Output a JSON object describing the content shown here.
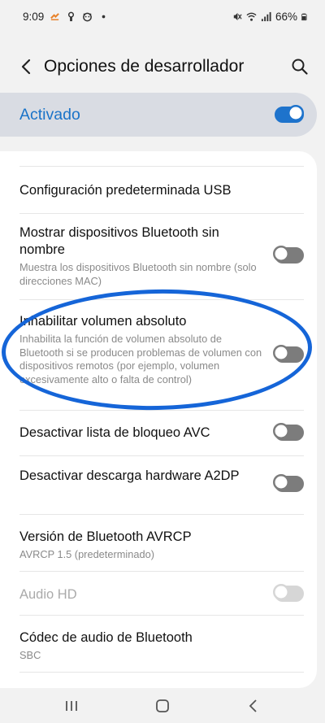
{
  "status_bar": {
    "time": "9:09",
    "battery": "66%",
    "icons": [
      "missed-call-icon",
      "lock-icon",
      "mascot-icon",
      "dot-icon",
      "mute-icon",
      "wifi-icon",
      "signal-icon",
      "battery-icon"
    ]
  },
  "header": {
    "title": "Opciones de desarrollador",
    "back_icon": "back-arrow-icon",
    "search_icon": "search-icon"
  },
  "master": {
    "label": "Activado",
    "enabled": true
  },
  "settings": [
    {
      "title": "Configuración predeterminada USB",
      "subtitle": "",
      "toggle": "none"
    },
    {
      "title": "Mostrar dispositivos Bluetooth sin nombre",
      "subtitle": "Muestra los dispositivos Bluetooth sin nombre (solo direcciones MAC)",
      "toggle": "off"
    },
    {
      "title": "Inhabilitar volumen absoluto",
      "subtitle": "Inhabilita la función de volumen absoluto de Bluetooth si se producen problemas de volumen con dispositivos remotos (por ejemplo, volumen excesivamente alto o falta de control)",
      "toggle": "off"
    },
    {
      "title": "Desactivar lista de bloqueo AVC",
      "subtitle": "",
      "toggle": "off"
    },
    {
      "title": "Desactivar descarga hardware A2DP",
      "subtitle": "",
      "toggle": "off"
    },
    {
      "title": "Versión de Bluetooth AVRCP",
      "subtitle": "AVRCP 1.5 (predeterminado)",
      "toggle": "none"
    },
    {
      "title": "Audio HD",
      "subtitle": "",
      "toggle": "disabled"
    },
    {
      "title": "Códec de audio de Bluetooth",
      "subtitle": "SBC",
      "toggle": "none"
    }
  ],
  "nav": {
    "recents_icon": "recents-icon",
    "home_icon": "home-icon",
    "back_icon": "nav-back-icon"
  },
  "colors": {
    "accent": "#1e73cc",
    "highlight_ellipse": "#1565d8"
  }
}
